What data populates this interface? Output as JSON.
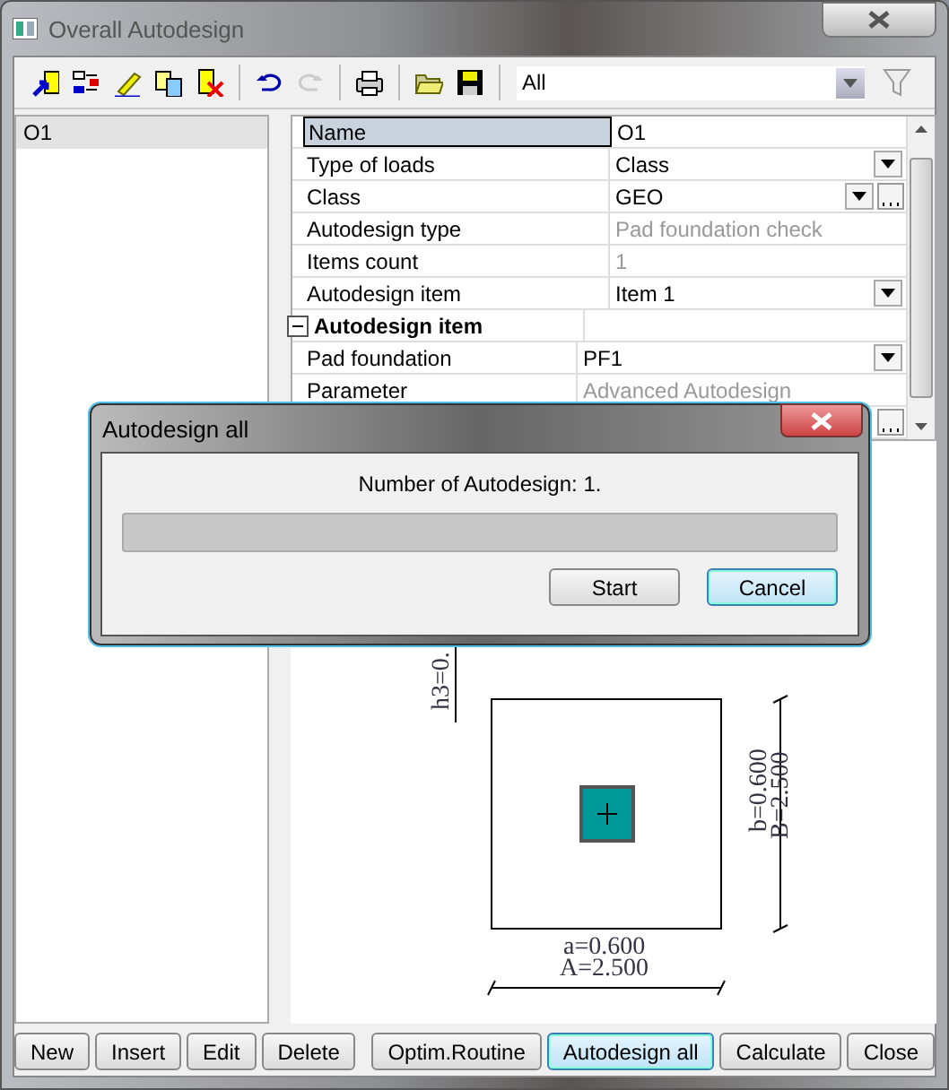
{
  "window": {
    "title": "Overall Autodesign"
  },
  "toolbar": {
    "tools": [
      {
        "kind": "insert",
        "disabled": false
      },
      {
        "kind": "move",
        "disabled": false
      },
      {
        "kind": "edit",
        "disabled": false
      },
      {
        "kind": "copy",
        "disabled": false
      },
      {
        "kind": "delete",
        "disabled": false
      },
      {
        "kind": "separator"
      },
      {
        "kind": "undo",
        "disabled": false
      },
      {
        "kind": "redo",
        "disabled": true
      },
      {
        "kind": "separator"
      },
      {
        "kind": "print",
        "disabled": false
      },
      {
        "kind": "separator"
      },
      {
        "kind": "open",
        "disabled": false
      },
      {
        "kind": "save",
        "disabled": false
      },
      {
        "kind": "separator"
      }
    ],
    "filter": {
      "value": "All"
    },
    "filter_button": {
      "disabled": true
    }
  },
  "list": [
    {
      "label": "O1",
      "selected": true
    }
  ],
  "properties": [
    {
      "kind": "text",
      "label": "Name",
      "value": "O1",
      "selected": true
    },
    {
      "kind": "dropdown",
      "label": "Type of loads",
      "value": "Class",
      "selected": false
    },
    {
      "kind": "dropdown-browse",
      "label": "Class",
      "value": "GEO",
      "selected": false
    },
    {
      "kind": "readonly",
      "label": "Autodesign type",
      "value": "Pad foundation check",
      "selected": false
    },
    {
      "kind": "readonly",
      "label": "Items count",
      "value": "1",
      "selected": false
    },
    {
      "kind": "dropdown",
      "label": "Autodesign item",
      "value": "Item 1",
      "selected": false
    },
    {
      "kind": "group",
      "label": "Autodesign item",
      "expanded": true,
      "children": [
        {
          "kind": "dropdown",
          "label": "Pad foundation",
          "value": "PF1"
        },
        {
          "kind": "readonly",
          "label": "Parameter",
          "value": "Advanced Autodesign"
        },
        {
          "kind": "browse"
        }
      ]
    }
  ],
  "drawing": {
    "labels": [
      "h3=0.",
      "b=0.600",
      "B=2.500",
      "a=0.600",
      "A=2.500"
    ]
  },
  "left_buttons": [
    {
      "label": "New",
      "default": false
    },
    {
      "label": "Insert",
      "default": false
    },
    {
      "label": "Edit",
      "default": false
    },
    {
      "label": "Delete",
      "default": false
    }
  ],
  "right_buttons": [
    {
      "label": "Optim.Routine",
      "default": false
    },
    {
      "label": "Autodesign all",
      "default": true
    },
    {
      "label": "Calculate",
      "default": false
    },
    {
      "label": "Close",
      "default": false
    }
  ],
  "dialog": {
    "title": "Autodesign all",
    "message": "Number of Autodesign: 1.",
    "level": 0,
    "buttons": [
      {
        "label": "Start",
        "default": false
      },
      {
        "label": "Cancel",
        "default": true
      }
    ]
  }
}
